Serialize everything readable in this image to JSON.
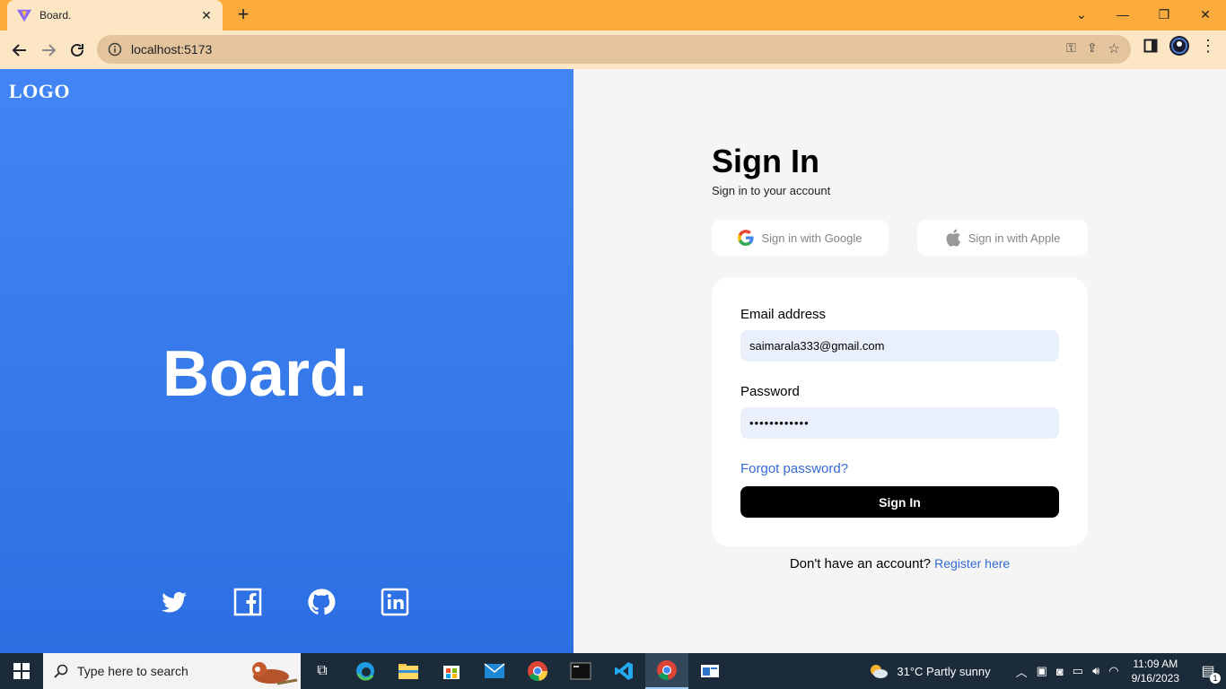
{
  "browser": {
    "tab_title": "Board.",
    "url": "localhost:5173"
  },
  "left_panel": {
    "logo": "LOGO",
    "brand": "Board.",
    "socials": [
      "twitter-icon",
      "facebook-icon",
      "github-icon",
      "linkedin-icon"
    ]
  },
  "signin": {
    "title": "Sign In",
    "subtitle": "Sign in to your account",
    "google_label": "Sign in with Google",
    "apple_label": "Sign in with Apple",
    "email_label": "Email address",
    "email_value": "saimarala333@gmail.com",
    "password_label": "Password",
    "password_value": "••••••••••••",
    "forgot_label": "Forgot password?",
    "submit_label": "Sign In",
    "register_prompt": "Don't have an account?",
    "register_link": "Register here"
  },
  "taskbar": {
    "search_placeholder": "Type here to search",
    "weather": "31°C  Partly sunny",
    "time": "11:09 AM",
    "date": "9/16/2023",
    "notifications": "1"
  },
  "colors": {
    "left_bg": "#4285f4",
    "accent_link": "#346bd4",
    "tab_bar": "#fbab3b",
    "toolbar": "#fde6c4"
  }
}
